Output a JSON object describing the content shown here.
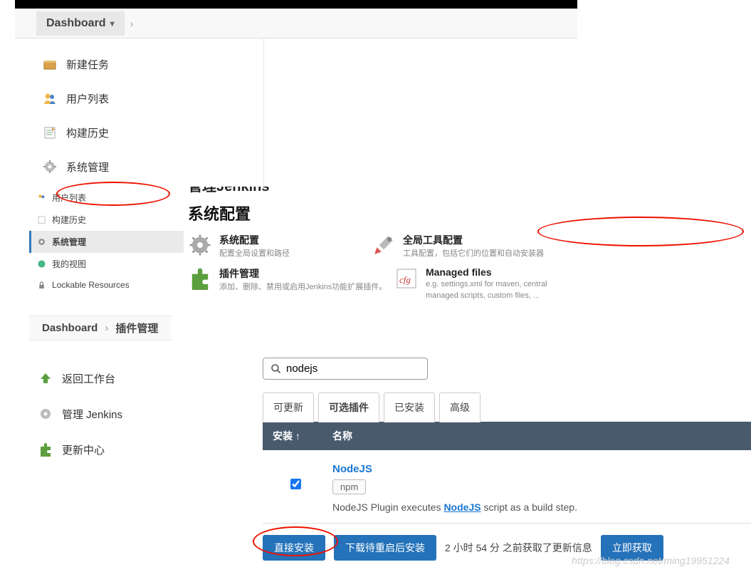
{
  "breadcrumb1": {
    "dashboard": "Dashboard"
  },
  "nav1": {
    "items": [
      {
        "label": "新建任务"
      },
      {
        "label": "用户列表"
      },
      {
        "label": "构建历史"
      },
      {
        "label": "系统管理"
      }
    ]
  },
  "nav2": {
    "items": [
      {
        "label": "用户列表"
      },
      {
        "label": "构建历史"
      },
      {
        "label": "系统管理"
      },
      {
        "label": "我的视图"
      },
      {
        "label": "Lockable Resources"
      }
    ]
  },
  "config": {
    "header_partial": "管理Jenkins",
    "section_title": "系统配置",
    "cards": [
      {
        "title": "系统配置",
        "desc": "配置全局设置和路径"
      },
      {
        "title": "全局工具配置",
        "desc": "工具配置，包括它们的位置和自动安装器"
      },
      {
        "title": "插件管理",
        "desc": "添加、删除、禁用或启用Jenkins功能扩展插件。"
      },
      {
        "title": "Managed files",
        "desc": "e.g. settings.xml for maven, central managed scripts, custom files, ..."
      }
    ]
  },
  "breadcrumb3": {
    "dashboard": "Dashboard",
    "plugins": "插件管理"
  },
  "nav3": {
    "items": [
      {
        "label": "返回工作台"
      },
      {
        "label": "管理 Jenkins"
      },
      {
        "label": "更新中心"
      }
    ]
  },
  "plugins": {
    "search_value": "nodejs",
    "tabs": [
      "可更新",
      "可选插件",
      "已安装",
      "高级"
    ],
    "active_tab_index": 1,
    "table_head": {
      "install": "安装 ↑",
      "name": "名称"
    },
    "row": {
      "checked": true,
      "name": "NodeJS",
      "tag": "npm",
      "desc_pre": "NodeJS Plugin executes ",
      "desc_link": "NodeJS",
      "desc_post": " script as a build step."
    },
    "actions": {
      "direct_install": "直接安装",
      "download_restart": "下载待重启后安装",
      "info": "2 小时 54 分 之前获取了更新信息",
      "fetch_now": "立即获取"
    }
  },
  "watermark": "https://blog.csdn.net/ming19951224"
}
